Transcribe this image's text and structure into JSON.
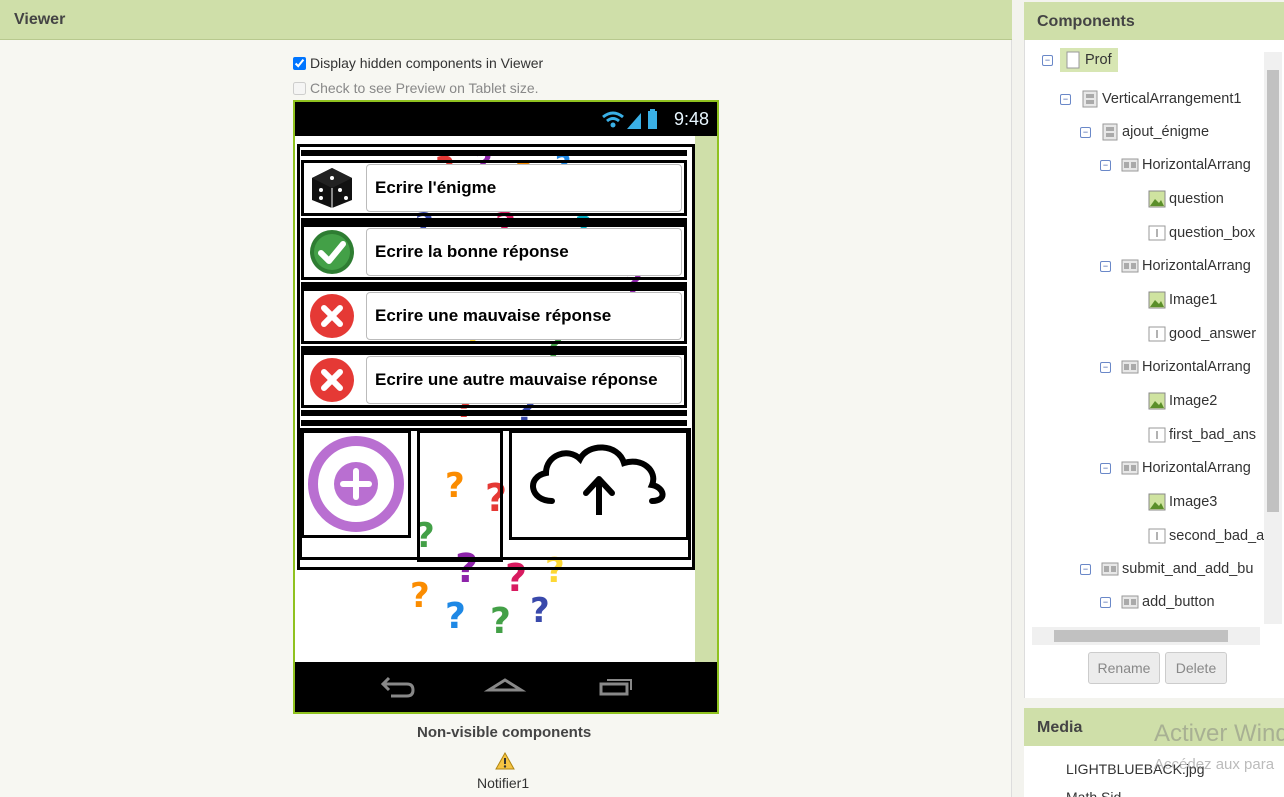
{
  "viewer": {
    "title": "Viewer",
    "display_hidden_label": "Display hidden components in Viewer",
    "display_hidden_checked": true,
    "tablet_preview_label": "Check to see Preview on Tablet size.",
    "tablet_preview_checked": false,
    "phone": {
      "time": "9:48",
      "rows": [
        {
          "label": "Ecrire l'énigme",
          "icon": "dice-icon"
        },
        {
          "label": "Ecrire la bonne réponse",
          "icon": "green-check-icon"
        },
        {
          "label": "Ecrire une mauvaise réponse",
          "icon": "red-x-icon"
        },
        {
          "label": "Ecrire une autre mauvaise réponse",
          "icon": "red-x-icon"
        }
      ],
      "add_icon": "add-circle-icon",
      "upload_icon": "cloud-upload-icon",
      "background": "question-marks-image"
    },
    "non_visible_title": "Non-visible components",
    "non_visible_items": [
      "Notifier1"
    ]
  },
  "components": {
    "title": "Components",
    "tree": [
      {
        "label": "Prof",
        "icon": "screen-icon",
        "selected": true
      },
      {
        "label": "VerticalArrangement1",
        "icon": "vertical-arrangement-icon"
      },
      {
        "label": "ajout_énigme",
        "icon": "vertical-arrangement-icon"
      },
      {
        "label": "HorizontalArrang",
        "icon": "horizontal-arrangement-icon"
      },
      {
        "label": "question",
        "icon": "image-icon"
      },
      {
        "label": "question_box",
        "icon": "textbox-icon"
      },
      {
        "label": "HorizontalArrang",
        "icon": "horizontal-arrangement-icon"
      },
      {
        "label": "Image1",
        "icon": "image-icon"
      },
      {
        "label": "good_answer",
        "icon": "textbox-icon"
      },
      {
        "label": "HorizontalArrang",
        "icon": "horizontal-arrangement-icon"
      },
      {
        "label": "Image2",
        "icon": "image-icon"
      },
      {
        "label": "first_bad_ans",
        "icon": "textbox-icon"
      },
      {
        "label": "HorizontalArrang",
        "icon": "horizontal-arrangement-icon"
      },
      {
        "label": "Image3",
        "icon": "image-icon"
      },
      {
        "label": "second_bad_a",
        "icon": "textbox-icon"
      },
      {
        "label": "submit_and_add_bu",
        "icon": "horizontal-arrangement-icon"
      },
      {
        "label": "add_button",
        "icon": "horizontal-arrangement-icon"
      }
    ],
    "rename_label": "Rename",
    "delete_label": "Delete"
  },
  "media": {
    "title": "Media",
    "items": [
      "LIGHTBLUEBACK.jpg",
      "Math Sid..."
    ]
  },
  "watermark": {
    "line1": "Activer Wind",
    "line2": "Accédez aux para"
  },
  "colors": {
    "panel_header": "#cfdfa9",
    "phone_border": "#8fc21f",
    "selection": "#d7e6b3"
  }
}
